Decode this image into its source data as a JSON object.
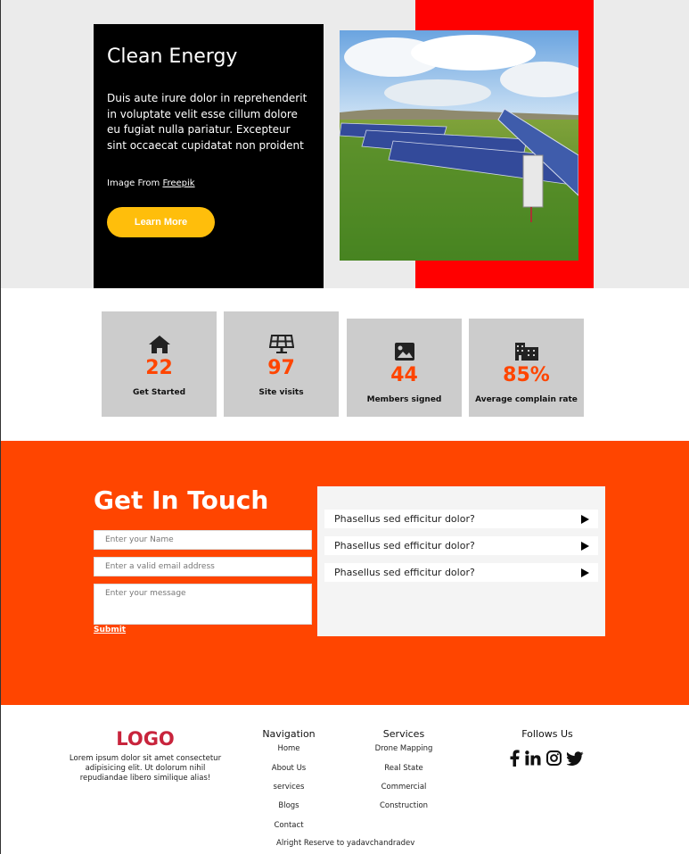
{
  "hero": {
    "title": "Clean Energy",
    "text": "Duis aute irure dolor in reprehenderit in voluptate velit esse cillum dolore eu fugiat nulla pariatur. Excepteur sint occaecat cupidatat non proident",
    "credit_prefix": "Image From ",
    "credit_link": "Freepik",
    "button_label": "Learn More",
    "colors": {
      "accent_red": "#ff0000",
      "button": "#ffbe0b",
      "card": "#000000"
    }
  },
  "stats": [
    {
      "icon": "home-icon",
      "value": "22",
      "label": "Get Started"
    },
    {
      "icon": "solar-panel-icon",
      "value": "97",
      "label": "Site visits"
    },
    {
      "icon": "image-icon",
      "value": "44",
      "label": "Members signed"
    },
    {
      "icon": "building-icon",
      "value": "85%",
      "label": "Average complain rate"
    }
  ],
  "contact": {
    "title": "Get In Touch",
    "name_placeholder": "Enter your Name",
    "email_placeholder": "Enter a valid email address",
    "message_placeholder": "Enter your message",
    "submit_label": "Submit",
    "faqs": [
      "Phasellus sed efficitur dolor?",
      "Phasellus sed efficitur dolor?",
      "Phasellus sed efficitur dolor?"
    ],
    "background": "#ff4500"
  },
  "footer": {
    "logo": "LOGO",
    "about": "Lorem ipsum dolor sit amet consectetur adipisicing elit. Ut dolorum nihil repudiandae libero similique alias!",
    "navigation": {
      "title": "Navigation",
      "links": [
        "Home",
        "About Us",
        "services",
        "Blogs",
        "Contact"
      ]
    },
    "services": {
      "title": "Services",
      "links": [
        "Drone Mapping",
        "Real State",
        "Commercial",
        "Construction"
      ]
    },
    "follow": {
      "title": "Follows Us",
      "icons": [
        "facebook-icon",
        "linkedin-icon",
        "instagram-icon",
        "twitter-icon"
      ]
    },
    "copyright": "Alright Reserve to yadavchandradev"
  }
}
